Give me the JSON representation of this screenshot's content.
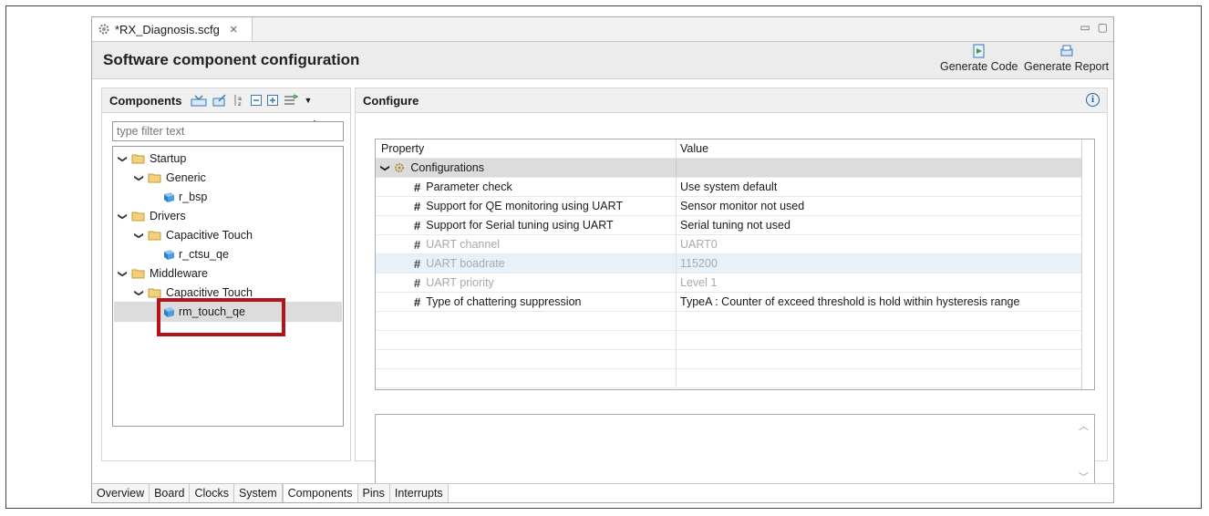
{
  "editor_tab": {
    "title": "*RX_Diagnosis.scfg"
  },
  "header": {
    "title": "Software component configuration",
    "generate_code": "Generate Code",
    "generate_report": "Generate Report"
  },
  "components": {
    "title": "Components",
    "filter_placeholder": "type filter text",
    "tree": {
      "startup": "Startup",
      "generic": "Generic",
      "r_bsp": "r_bsp",
      "drivers": "Drivers",
      "cap_touch_1": "Capacitive Touch",
      "r_ctsu_qe": "r_ctsu_qe",
      "middleware": "Middleware",
      "cap_touch_2": "Capacitive Touch",
      "rm_touch_qe": "rm_touch_qe"
    }
  },
  "configure": {
    "title": "Configure",
    "col_property": "Property",
    "col_value": "Value",
    "group": "Configurations",
    "rows": [
      {
        "property": "Parameter check",
        "value": "Use system default"
      },
      {
        "property": "Support for QE monitoring using UART",
        "value": "Sensor monitor not used"
      },
      {
        "property": "Support for Serial tuning using UART",
        "value": "Serial tuning not used"
      },
      {
        "property": "UART channel",
        "value": "UART0"
      },
      {
        "property": "UART boadrate",
        "value": "115200"
      },
      {
        "property": "UART priority",
        "value": "Level 1"
      },
      {
        "property": "Type of chattering suppression",
        "value": "TypeA : Counter of exceed threshold is hold within hysteresis range"
      }
    ]
  },
  "bottom_tabs": [
    "Overview",
    "Board",
    "Clocks",
    "System",
    "Components",
    "Pins",
    "Interrupts"
  ]
}
